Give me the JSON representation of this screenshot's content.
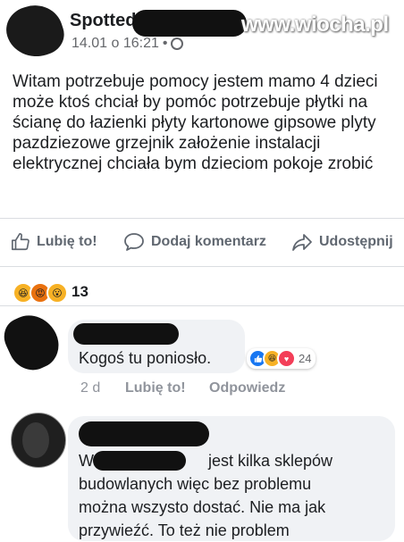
{
  "post": {
    "author_visible": "Spotted",
    "time": "14.01 o 16:21",
    "separator": "•",
    "privacy_icon": "globe-icon",
    "text": "Witam potrzebuje pomocy  jestem mamo 4 dzieci  może ktoś chciał by pomóc potrzebuje płytki na ścianę do łazienki płyty kartonowe gipsowe plyty pazdziezowe grzejnik założenie instalacji elektrycznej chciała bym dzieciom pokoje zrobić"
  },
  "watermark": "www.wiocha.pl",
  "actions": {
    "like": "Lubię to!",
    "comment": "Dodaj komentarz",
    "share": "Udostępnij"
  },
  "reactions": {
    "icons": [
      "haha-icon",
      "angry-icon",
      "wow-icon"
    ],
    "count": "13"
  },
  "comments": [
    {
      "text": "Kogoś tu poniosło.",
      "reaction_icons": [
        "like-icon",
        "haha-icon",
        "love-icon"
      ],
      "reaction_count": "24",
      "age": "2 d",
      "like_label": "Lubię to!",
      "reply_label": "Odpowiedz"
    },
    {
      "text_start": "W",
      "text_rest": "jest kilka sklepów budowlanych więc bez problemu można wszysto dostać. Nie ma jak przywieźć. To też nie problem"
    }
  ],
  "colors": {
    "text": "#1c1e21",
    "secondary": "#65676b",
    "bubble": "#f0f2f5",
    "like_blue": "#1877f2",
    "love_red": "#f33e58",
    "haha_yellow": "#f7b125"
  }
}
